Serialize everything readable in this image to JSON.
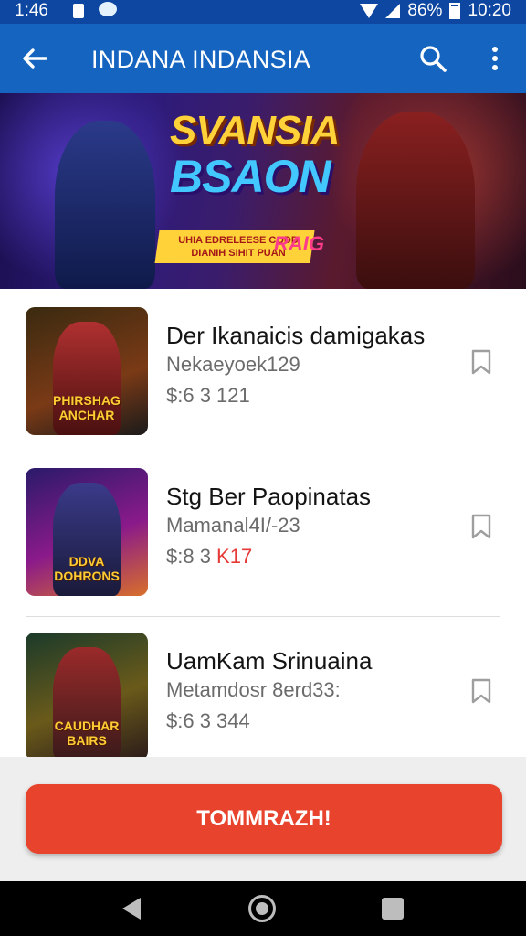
{
  "status_bar": {
    "time": "1:46",
    "battery": "86%",
    "clock": "10:20"
  },
  "app_bar": {
    "title": "INDANA INDANSIA",
    "back_icon": "arrow-left-icon",
    "search_icon": "search-icon",
    "menu_icon": "more-vert-icon"
  },
  "banner": {
    "title_line1": "SVANSIA",
    "title_line2": "BSAON",
    "strip_text_line1": "UHIA EDRELEESE CODD",
    "strip_text_line2": "DIANIH SIHIT PUAN",
    "tag": "RAIG"
  },
  "items": [
    {
      "name": "Der Ikanaicis damigakas",
      "subtitle": "Nekaeyoek129",
      "price": "$:6 3  121",
      "price_accent": "",
      "thumb_caption": "PHIRSHAG\nANCHAR",
      "bookmark_icon": "bookmark-outline-icon"
    },
    {
      "name": "Stg Ber Paopinatas",
      "subtitle": "Mamanal4I/-23",
      "price": "$:8 3 ",
      "price_accent": "K17",
      "thumb_caption": "DDVA\nDOHRONS",
      "bookmark_icon": "bookmark-outline-icon"
    },
    {
      "name": "UamKam Srinuaina",
      "subtitle": "Metamdosr 8erd33:",
      "price": "$:6 3  344",
      "price_accent": "",
      "thumb_caption": "CAUDHAR\nBAIRS",
      "bookmark_icon": "bookmark-outline-icon"
    }
  ],
  "cta": {
    "label": "TOMMRAZH!"
  },
  "colors": {
    "app_bar": "#1565c0",
    "status_bar": "#0d47a1",
    "cta": "#e8432c",
    "price_accent": "#e53935"
  }
}
